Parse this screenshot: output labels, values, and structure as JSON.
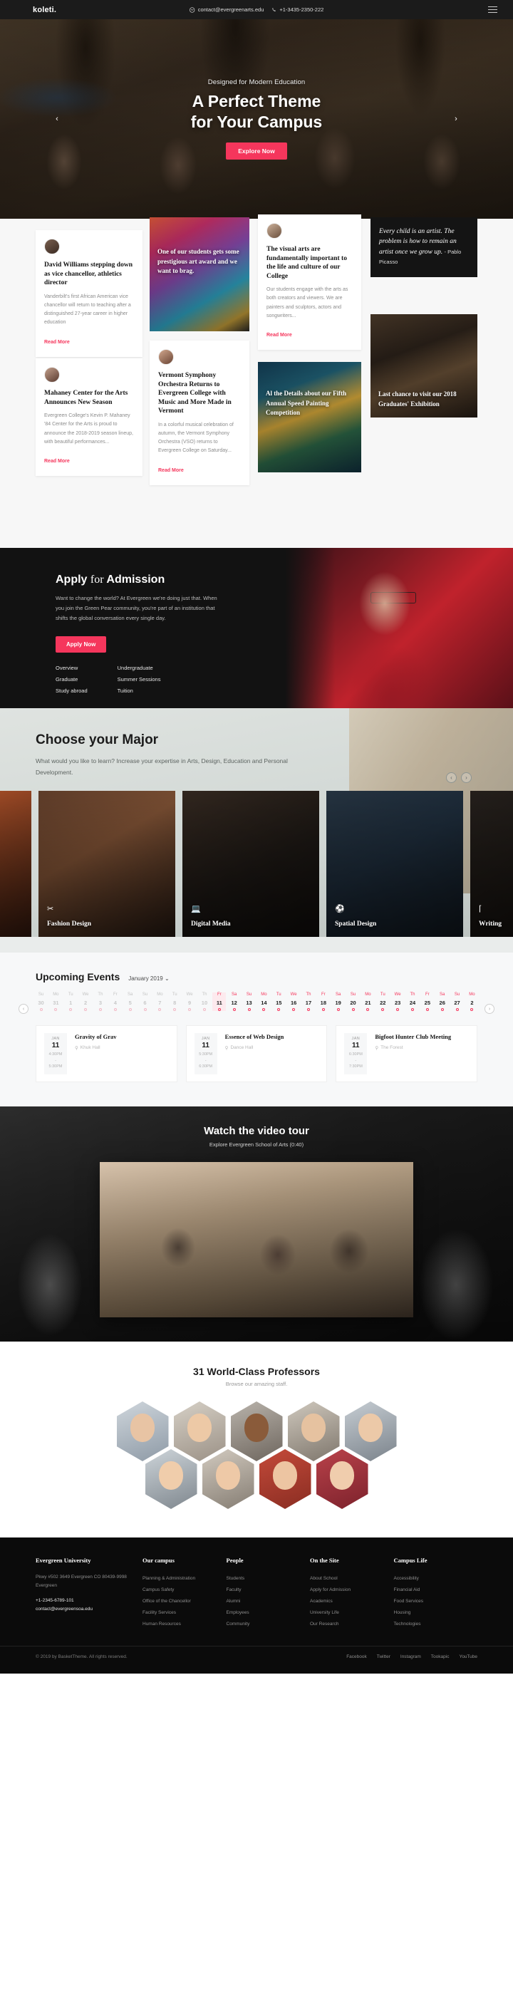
{
  "topbar": {
    "brand": "koleti.",
    "email": "contact@evergreenarts.edu",
    "phone": "+1-3435-2350-222",
    "email_icon": "envelope-icon",
    "phone_icon": "phone-icon",
    "menu_icon": "hamburger-menu-icon"
  },
  "hero": {
    "kicker": "Designed for Modern Education",
    "title_line1": "A Perfect Theme",
    "title_line2": "for Your Campus",
    "cta": "Explore Now",
    "prev": "‹",
    "next": "›"
  },
  "news": {
    "cards": [
      {
        "title": "David Williams stepping down as vice chancellor, athletics director",
        "body": "Vanderbilt's first African American vice chancellor will return to teaching after a distinguished 27-year career in higher education",
        "more": "Read More"
      },
      {
        "title": "Mahaney Center for the Arts Announces New Season",
        "body": "Evergreen College's Kevin P. Mahaney '84 Center for the Arts is proud to announce the 2018-2019 season lineup, with beautiful performances...",
        "more": "Read More"
      },
      {
        "title": "Vermont Symphony Orchestra Returns to Evergreen College with Music and More Made in Vermont",
        "body": "In a colorful musical celebration of autumn, the Vermont Symphony Orchestra (VSO) returns to Evergreen College on Saturday...",
        "more": "Read More"
      },
      {
        "title": "The visual arts are fundamentally important to the life and culture of our College",
        "body": "Our students engage with the arts as both creators and viewers. We are painters and sculptors, actors and songwriters...",
        "more": "Read More"
      }
    ],
    "image_card_1": "One of our students gets some prestigious art award and we want to brag.",
    "image_card_2": "Al the Details about our Fifth Annual Speed Painting Competition",
    "image_card_3": "Last chance to visit our 2018 Graduates' Exhibition",
    "quote": "Every child is an artist. The problem is how to remain an artist once we grow up.",
    "quote_author": "- Pablo Picasso"
  },
  "admission": {
    "title_bold": "Apply",
    "title_serif": "for",
    "title_bold2": "Admission",
    "body": "Want to change the world? At Evergreen we're doing just that. When you join the Green Pear community, you're part of an institution that shifts the global conversation every single day.",
    "button": "Apply Now",
    "links_col1": [
      "Overview",
      "Graduate",
      "Study abroad"
    ],
    "links_col2": [
      "Undergraduate",
      "Summer Sessions",
      "Tuition"
    ]
  },
  "majors": {
    "title": "Choose your Major",
    "subtitle": "What would you like to learn? Increase your expertise in Arts, Design, Education and Personal Development.",
    "prev": "‹",
    "next": "›",
    "items": [
      {
        "label": "",
        "icon": ""
      },
      {
        "label": "Fashion Design",
        "icon": "scissors-icon"
      },
      {
        "label": "Digital Media",
        "icon": "monitor-icon"
      },
      {
        "label": "Spatial Design",
        "icon": "ball-icon"
      },
      {
        "label": "Writing",
        "icon": "text-cursor-icon"
      }
    ]
  },
  "events": {
    "title": "Upcoming Events",
    "month": "January 2019",
    "chevron": "⌄",
    "prev": "‹",
    "next": "›",
    "calendar": [
      {
        "dn": "Su",
        "dd": "30",
        "active": false,
        "sel": false
      },
      {
        "dn": "Mo",
        "dd": "31",
        "active": false,
        "sel": false
      },
      {
        "dn": "Tu",
        "dd": "1",
        "active": false,
        "sel": false
      },
      {
        "dn": "We",
        "dd": "2",
        "active": false,
        "sel": false
      },
      {
        "dn": "Th",
        "dd": "3",
        "active": false,
        "sel": false
      },
      {
        "dn": "Fr",
        "dd": "4",
        "active": false,
        "sel": false
      },
      {
        "dn": "Sa",
        "dd": "5",
        "active": false,
        "sel": false
      },
      {
        "dn": "Su",
        "dd": "6",
        "active": false,
        "sel": false
      },
      {
        "dn": "Mo",
        "dd": "7",
        "active": false,
        "sel": false
      },
      {
        "dn": "Tu",
        "dd": "8",
        "active": false,
        "sel": false
      },
      {
        "dn": "We",
        "dd": "9",
        "active": false,
        "sel": false
      },
      {
        "dn": "Th",
        "dd": "10",
        "active": false,
        "sel": false
      },
      {
        "dn": "Fr",
        "dd": "11",
        "active": true,
        "sel": true
      },
      {
        "dn": "Sa",
        "dd": "12",
        "active": true,
        "sel": false
      },
      {
        "dn": "Su",
        "dd": "13",
        "active": true,
        "sel": false
      },
      {
        "dn": "Mo",
        "dd": "14",
        "active": true,
        "sel": false
      },
      {
        "dn": "Tu",
        "dd": "15",
        "active": true,
        "sel": false
      },
      {
        "dn": "We",
        "dd": "16",
        "active": true,
        "sel": false
      },
      {
        "dn": "Th",
        "dd": "17",
        "active": true,
        "sel": false
      },
      {
        "dn": "Fr",
        "dd": "18",
        "active": true,
        "sel": false
      },
      {
        "dn": "Sa",
        "dd": "19",
        "active": true,
        "sel": false
      },
      {
        "dn": "Su",
        "dd": "20",
        "active": true,
        "sel": false
      },
      {
        "dn": "Mo",
        "dd": "21",
        "active": true,
        "sel": false
      },
      {
        "dn": "Tu",
        "dd": "22",
        "active": true,
        "sel": false
      },
      {
        "dn": "We",
        "dd": "23",
        "active": true,
        "sel": false
      },
      {
        "dn": "Th",
        "dd": "24",
        "active": true,
        "sel": false
      },
      {
        "dn": "Fr",
        "dd": "25",
        "active": true,
        "sel": false
      },
      {
        "dn": "Sa",
        "dd": "26",
        "active": true,
        "sel": false
      },
      {
        "dn": "Su",
        "dd": "27",
        "active": true,
        "sel": false
      },
      {
        "dn": "Mo",
        "dd": "2",
        "active": true,
        "sel": false
      }
    ],
    "list": [
      {
        "month": "JAN",
        "day": "11",
        "start": "4:30PM",
        "sep": "-",
        "end": "5:30PM",
        "title": "Gravity of Grav",
        "loc": "Khuk Hall",
        "pin": "location-pin-icon"
      },
      {
        "month": "JAN",
        "day": "11",
        "start": "5:30PM",
        "sep": "-",
        "end": "6:30PM",
        "title": "Essence of Web Design",
        "loc": "Dance Hall",
        "pin": "location-pin-icon"
      },
      {
        "month": "JAN",
        "day": "11",
        "start": "6:30PM",
        "sep": "-",
        "end": "7:30PM",
        "title": "Bigfoot Hunter Club Meeting",
        "loc": "The Forest",
        "pin": "location-pin-icon"
      }
    ]
  },
  "video": {
    "title": "Watch the video tour",
    "subtitle": "Explore Evergreen School of Arts (0:40)"
  },
  "professors": {
    "title": "31 World-Class Professors",
    "subtitle": "Browse our amazing staff."
  },
  "footer": {
    "brand": "Evergreen University",
    "address": "Pkwy #502 3649 Evergreen CO 80439-9998 Evergreen",
    "phone": "+1-2345-6789-101",
    "email": "contact@evergreensoa.edu",
    "columns": [
      {
        "heading": "Our campus",
        "items": [
          "Planning & Administration",
          "Campus Safety",
          "Office of the Chancellor",
          "Facility Services",
          "Human Resources"
        ]
      },
      {
        "heading": "People",
        "items": [
          "Students",
          "Faculty",
          "Alumni",
          "Employees",
          "Community"
        ]
      },
      {
        "heading": "On the Site",
        "items": [
          "About School",
          "Apply for Admission",
          "Academics",
          "University Life",
          "Our Research"
        ]
      },
      {
        "heading": "Campus Life",
        "items": [
          "Accessibility",
          "Financial Aid",
          "Food Services",
          "Housing",
          "Technologies"
        ]
      }
    ],
    "copyright": "© 2019 by BasketTheme. All rights reserved.",
    "social": [
      "Facebook",
      "Twitter",
      "Instagram",
      "Tookapic",
      "YouTube"
    ]
  },
  "colors": {
    "accent": "#f5365c",
    "dark": "#121212",
    "topbar": "#1b1b1b"
  }
}
